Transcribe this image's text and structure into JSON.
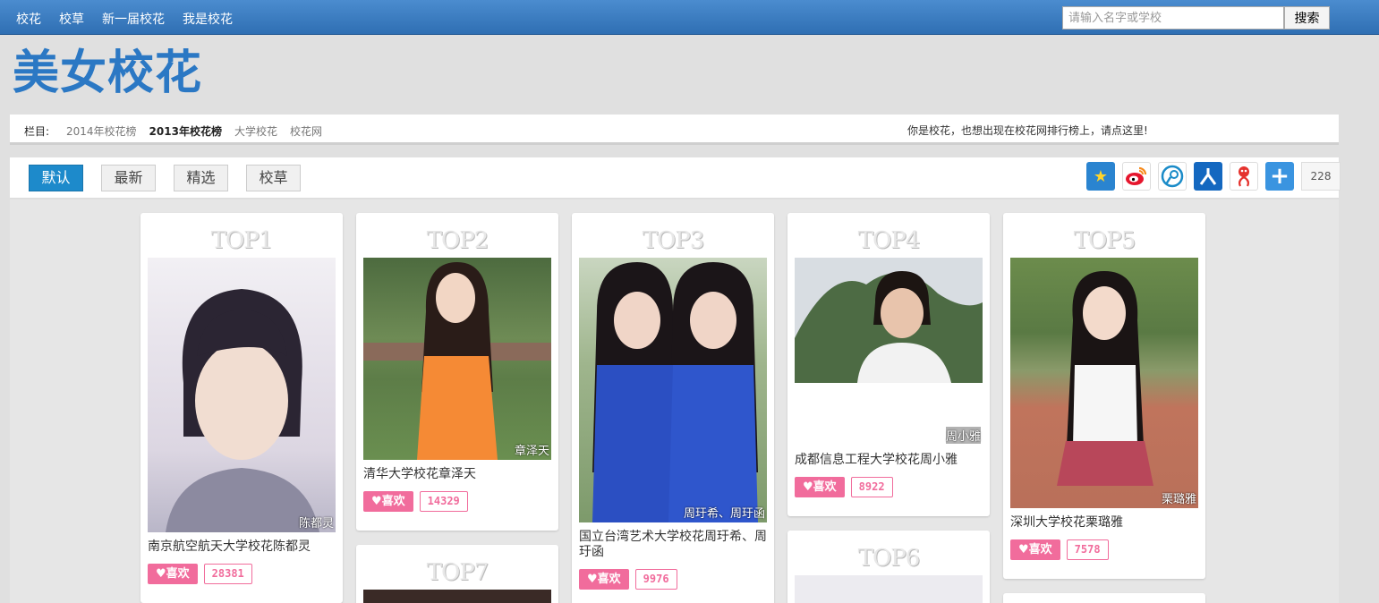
{
  "topnav": [
    "校花",
    "校草",
    "新一届校花",
    "我是校花"
  ],
  "search": {
    "placeholder": "请输入名字或学校",
    "button": "搜索"
  },
  "logo": "美女校花",
  "category": {
    "prefix": "栏目:",
    "links": [
      "2014年校花榜",
      "2013年校花榜",
      "大学校花",
      "校花网"
    ],
    "notice": "你是校花，也想出现在校花网排行榜上，请点这里!"
  },
  "filters": [
    "默认",
    "最新",
    "精选",
    "校草"
  ],
  "share": {
    "count": "228",
    "icons": [
      "qzone-star-icon",
      "weibo-icon",
      "tencent-weibo-icon",
      "renren-icon",
      "kaixin-icon",
      "more-plus-icon"
    ]
  },
  "cards": [
    {
      "rank": "TOP1",
      "caption": "陈都灵",
      "title": "南京航空航天大学校花陈都灵",
      "like": "♥喜欢",
      "count": "28381"
    },
    {
      "rank": "TOP2",
      "caption": "章泽天",
      "title": "清华大学校花章泽天",
      "like": "♥喜欢",
      "count": "14329"
    },
    {
      "rank": "TOP3",
      "caption": "周玗希、周玗函",
      "title": "国立台湾艺术大学校花周玗希、周玗函",
      "like": "♥喜欢",
      "count": "9976"
    },
    {
      "rank": "TOP4",
      "caption": "周小雅",
      "title": "成都信息工程大学校花周小雅",
      "like": "♥喜欢",
      "count": "8922"
    },
    {
      "rank": "TOP5",
      "caption": "栗璐雅",
      "title": "深圳大学校花栗璐雅",
      "like": "♥喜欢",
      "count": "7578"
    },
    {
      "rank": "TOP7"
    },
    {
      "rank": "TOP6"
    }
  ]
}
